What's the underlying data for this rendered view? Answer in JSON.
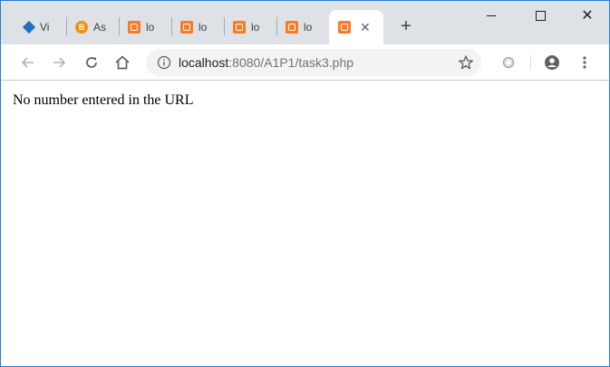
{
  "tabs": [
    {
      "title": "Vi",
      "favicon": "diamond-icon",
      "active": false
    },
    {
      "title": "As",
      "favicon": "bitcoin-icon",
      "active": false
    },
    {
      "title": "lo",
      "favicon": "xampp-icon",
      "active": false
    },
    {
      "title": "lo",
      "favicon": "xampp-icon",
      "active": false
    },
    {
      "title": "lo",
      "favicon": "xampp-icon",
      "active": false
    },
    {
      "title": "lo",
      "favicon": "xampp-icon",
      "active": false
    },
    {
      "title": "",
      "favicon": "xampp-icon",
      "active": true
    }
  ],
  "tab_favicon_letters": {
    "bitcoin": "B"
  },
  "new_tab_label": "+",
  "window_controls": {
    "close_glyph": "✕"
  },
  "address_bar": {
    "host": "localhost",
    "path": ":8080/A1P1/task3.php"
  },
  "page": {
    "message": "No number entered in the URL"
  },
  "colors": {
    "tabstrip": "#dee1e6",
    "accent_border": "#2b7cd3",
    "xampp_orange": "#fb7a24",
    "omnibox": "#f1f3f4"
  }
}
